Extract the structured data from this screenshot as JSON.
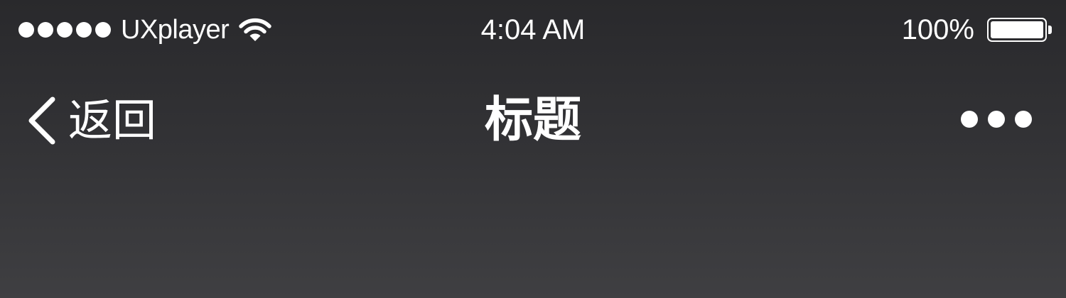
{
  "status_bar": {
    "signal_bars": 5,
    "carrier": "UXplayer",
    "wifi_icon": "wifi-icon",
    "time": "4:04 AM",
    "battery_percent": "100%",
    "battery_level": 1.0
  },
  "nav_bar": {
    "back_icon": "chevron-left-icon",
    "back_label": "返回",
    "title": "标题",
    "more_icon": "more-horizontal-icon"
  },
  "colors": {
    "background_top": "#29292c",
    "background_bottom": "#3f3f42",
    "foreground": "#ffffff"
  }
}
